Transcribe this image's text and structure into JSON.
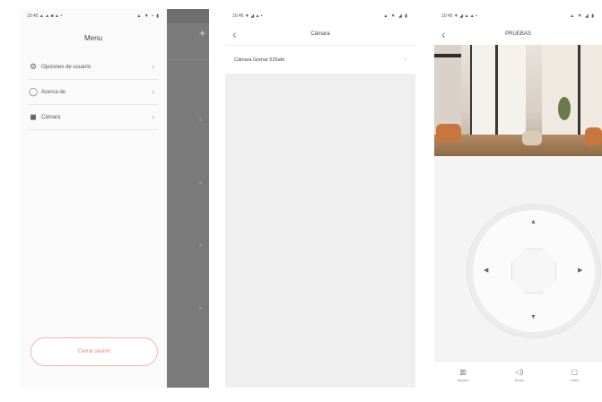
{
  "phone1": {
    "status_time": "10:45 ▲ ▲ ■ ▲ •",
    "status_icons": "▲ ▼ ▪ ▮",
    "title": "Menu",
    "items": [
      {
        "label": "Opciones de usuario",
        "icon": "user-settings-icon"
      },
      {
        "label": "Acerca de",
        "icon": "info-icon"
      },
      {
        "label": "Cámara",
        "icon": "camera-icon"
      }
    ],
    "chevron": "›",
    "logout_label": "Cerrar sesión",
    "overlay_plus": "+"
  },
  "phone2": {
    "status_time": "10:46 ▼ ◢ ▲ •",
    "status_icons": "▲ ▼ ◢ ▮",
    "back": "‹",
    "title": "Cámara",
    "camera_row": "Cámara Gomar 625afe",
    "chevron": "›"
  },
  "phone3": {
    "status_time": "10:45 ▼ ◢ ▲ ▲ •",
    "status_icons": "▲ ▼ ◢ ▮",
    "back": "‹",
    "title": "PRUEBAS",
    "arrows": {
      "up": "▲",
      "down": "▼",
      "left": "◀",
      "right": "▶"
    },
    "tabs": [
      {
        "label": "Ajustes",
        "icon": "▥"
      },
      {
        "label": "Audio",
        "icon": "◁)"
      },
      {
        "label": "Vídeo",
        "icon": "▢"
      }
    ]
  }
}
